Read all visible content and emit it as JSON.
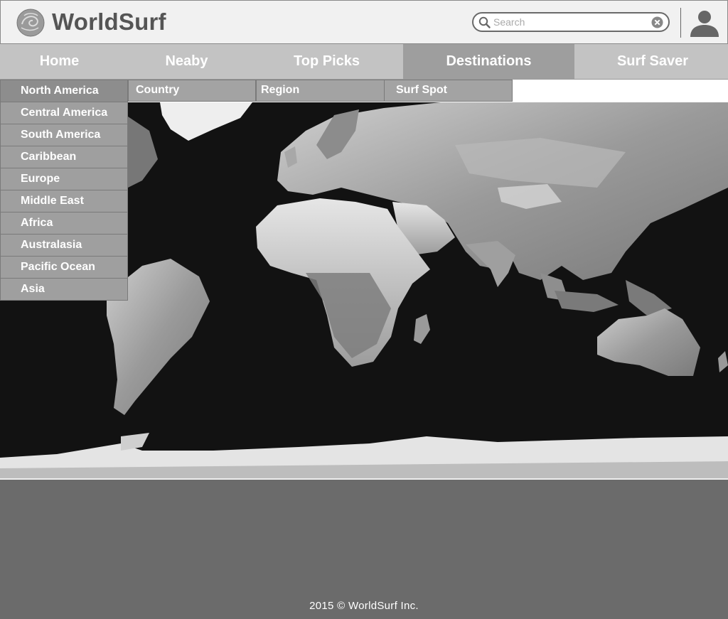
{
  "header": {
    "brand": "WorldSurf",
    "search": {
      "placeholder": "Search",
      "value": ""
    },
    "icons": [
      "logo-mark",
      "search-icon",
      "clear-icon",
      "user-avatar-icon"
    ]
  },
  "nav": {
    "items": [
      {
        "label": "Home"
      },
      {
        "label": "Neaby"
      },
      {
        "label": "Top Picks"
      },
      {
        "label": "Destinations",
        "active": true
      },
      {
        "label": "Surf Saver"
      }
    ]
  },
  "destinations_menu": {
    "regions": [
      "North America",
      "Central America",
      "South America",
      "Caribbean",
      "Europe",
      "Middle East",
      "Africa",
      "Australasia",
      "Pacific Ocean",
      "Asia"
    ],
    "selected": "North America",
    "columns": [
      "Country",
      "Region",
      "Surf Spot"
    ]
  },
  "footer": {
    "copyright": "2015 © WorldSurf Inc."
  },
  "colors": {
    "header_bg": "#f1f1f1",
    "nav_bg": "#c3c3c3",
    "nav_active_bg": "#9e9e9e",
    "menu_bg": "#9f9f9f",
    "footer_bg": "#6b6b6b",
    "map_ocean": "#111111"
  }
}
